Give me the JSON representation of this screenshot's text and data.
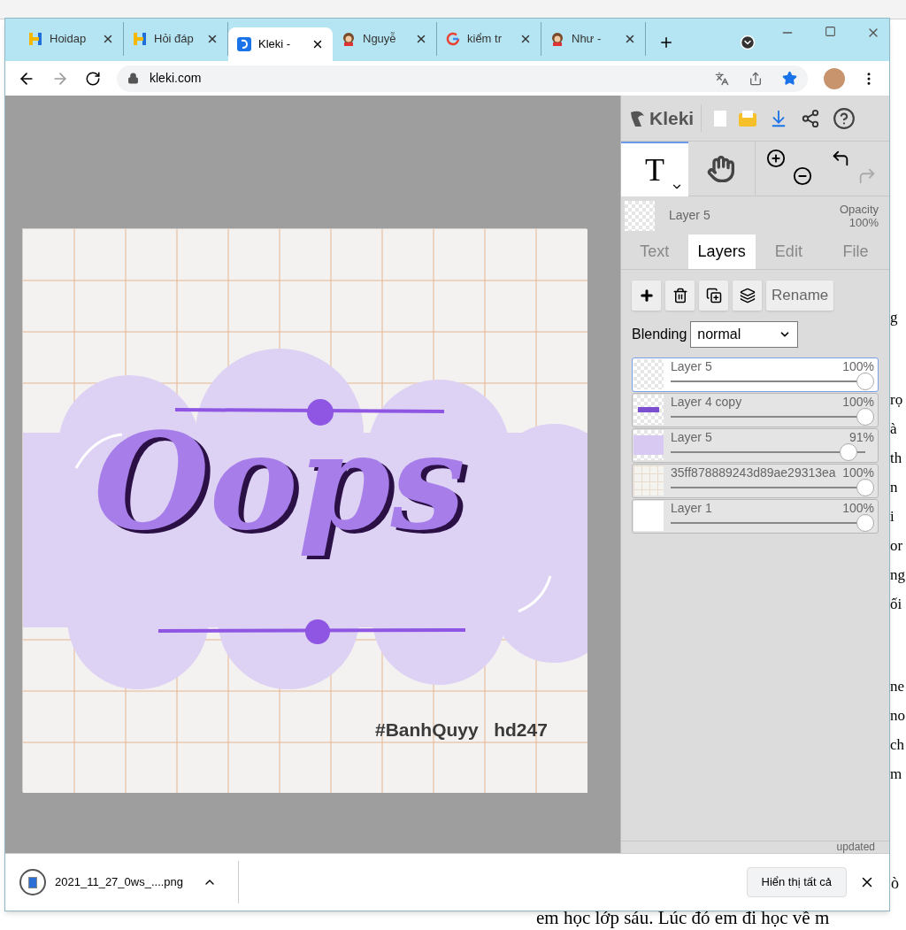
{
  "browser": {
    "tabs": [
      {
        "title": "Hoidap",
        "kind": "h-logo",
        "selected": false
      },
      {
        "title": "Hỏi đáp",
        "kind": "h-logo",
        "selected": false
      },
      {
        "title": "Kleki -",
        "kind": "kleki",
        "selected": true
      },
      {
        "title": "Nguyễ",
        "kind": "avatar",
        "selected": false
      },
      {
        "title": "kiểm tr",
        "kind": "google",
        "selected": false
      },
      {
        "title": "Như -",
        "kind": "avatar",
        "selected": false
      }
    ],
    "url": "kleki.com",
    "download": {
      "file": "2021_11_27_0ws_....png"
    },
    "show_all": "Hiển thị tất cả"
  },
  "app": {
    "logo": "Kleki",
    "tool_letter": "T",
    "current_layer": {
      "name": "Layer 5",
      "opacity_label": "Opacity",
      "opacity": "100%"
    },
    "tabs": [
      {
        "label": "Text",
        "selected": false
      },
      {
        "label": "Layers",
        "selected": true
      },
      {
        "label": "Edit",
        "selected": false
      },
      {
        "label": "File",
        "selected": false
      }
    ],
    "rename": "Rename",
    "blending_label": "Blending",
    "blending": "normal",
    "layers": [
      {
        "name": "Layer 5",
        "opacity": "100%",
        "level": 1,
        "selected": true,
        "kind": "transparent"
      },
      {
        "name": "Layer 4 copy",
        "opacity": "100%",
        "level": 1,
        "selected": false,
        "kind": "artwork"
      },
      {
        "name": "Layer 5",
        "opacity": "91%",
        "level": 0.91,
        "selected": false,
        "kind": "lilac"
      },
      {
        "name": "35ff878889243d89ae29313ea",
        "opacity": "100%",
        "level": 1,
        "selected": false,
        "kind": "grid"
      },
      {
        "name": "Layer 1",
        "opacity": "100%",
        "level": 1,
        "selected": false,
        "kind": "white"
      }
    ],
    "status": "updated"
  },
  "canvas": {
    "lettering": "Oops",
    "caption": "#BanhQuyy   hd247"
  },
  "document": {
    "edge_blocks": [
      {
        "lines": [
          "g"
        ]
      },
      {
        "lines": [
          "rọ",
          "à",
          "th",
          "n",
          "i",
          "or",
          "ng",
          "ối"
        ]
      },
      {
        "lines": [
          "ne",
          "no",
          "ch",
          "m"
        ]
      }
    ],
    "edge_after_bar": "ò",
    "bottom_line": "em học lớp sáu. Lúc đó em đi học về m"
  }
}
